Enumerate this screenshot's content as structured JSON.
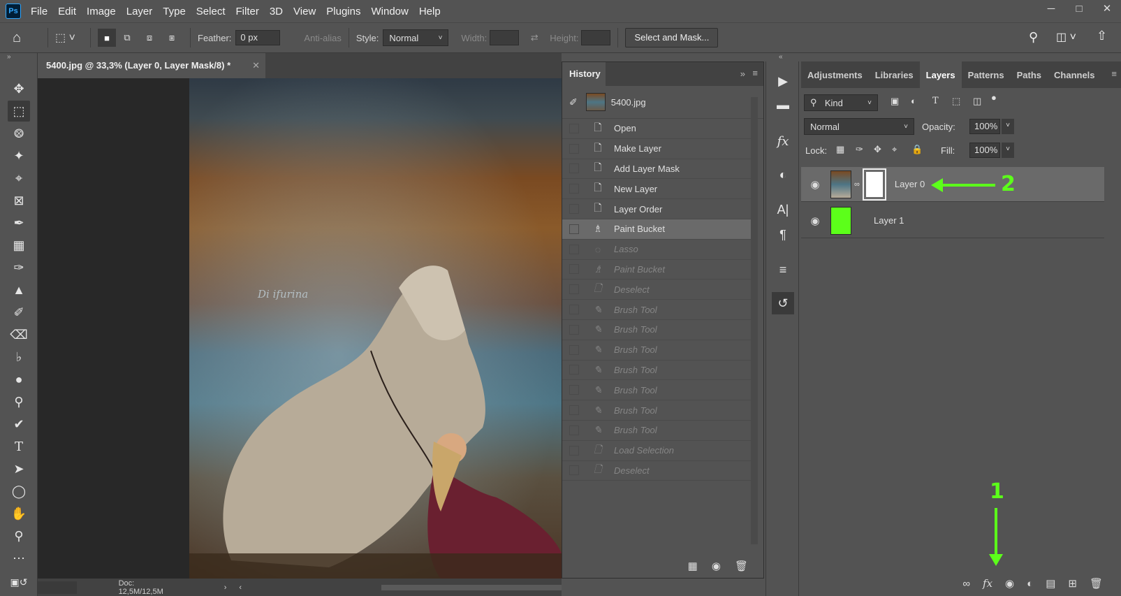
{
  "app": {
    "logo": "Ps"
  },
  "menu": [
    "File",
    "Edit",
    "Image",
    "Layer",
    "Type",
    "Select",
    "Filter",
    "3D",
    "View",
    "Plugins",
    "Window",
    "Help"
  ],
  "window_controls": [
    "minimize-icon",
    "restore-icon",
    "close-icon"
  ],
  "options": {
    "feather_label": "Feather:",
    "feather_value": "0 px",
    "antialias_label": "Anti-alias",
    "style_label": "Style:",
    "style_value": "Normal",
    "width_label": "Width:",
    "height_label": "Height:",
    "select_mask_label": "Select and Mask..."
  },
  "document": {
    "tab_title": "5400.jpg @ 33,3% (Layer 0, Layer Mask/8) *",
    "watermark": "Di ifurina",
    "status": "Doc: 12,5M/12,5M"
  },
  "history": {
    "title": "History",
    "snapshot": "5400.jpg",
    "items": [
      {
        "label": "Open",
        "icon": "document-icon",
        "state": "normal"
      },
      {
        "label": "Make Layer",
        "icon": "document-icon",
        "state": "normal"
      },
      {
        "label": "Add Layer Mask",
        "icon": "document-icon",
        "state": "normal"
      },
      {
        "label": "New Layer",
        "icon": "document-icon",
        "state": "normal"
      },
      {
        "label": "Layer Order",
        "icon": "document-icon",
        "state": "normal"
      },
      {
        "label": "Paint Bucket",
        "icon": "paint-bucket-icon",
        "state": "active"
      },
      {
        "label": "Lasso",
        "icon": "lasso-icon",
        "state": "undone"
      },
      {
        "label": "Paint Bucket",
        "icon": "paint-bucket-icon",
        "state": "undone"
      },
      {
        "label": "Deselect",
        "icon": "document-icon",
        "state": "undone"
      },
      {
        "label": "Brush Tool",
        "icon": "brush-icon",
        "state": "undone"
      },
      {
        "label": "Brush Tool",
        "icon": "brush-icon",
        "state": "undone"
      },
      {
        "label": "Brush Tool",
        "icon": "brush-icon",
        "state": "undone"
      },
      {
        "label": "Brush Tool",
        "icon": "brush-icon",
        "state": "undone"
      },
      {
        "label": "Brush Tool",
        "icon": "brush-icon",
        "state": "undone"
      },
      {
        "label": "Brush Tool",
        "icon": "brush-icon",
        "state": "undone"
      },
      {
        "label": "Brush Tool",
        "icon": "brush-icon",
        "state": "undone"
      },
      {
        "label": "Load Selection",
        "icon": "document-icon",
        "state": "undone"
      },
      {
        "label": "Deselect",
        "icon": "document-icon",
        "state": "undone"
      }
    ]
  },
  "layers_panel": {
    "tabs": [
      "Adjustments",
      "Libraries",
      "Layers",
      "Patterns",
      "Paths",
      "Channels"
    ],
    "active_tab": "Layers",
    "filter_kind": "Kind",
    "blend_mode": "Normal",
    "opacity_label": "Opacity:",
    "opacity_value": "100%",
    "lock_label": "Lock:",
    "fill_label": "Fill:",
    "fill_value": "100%",
    "layers": [
      {
        "name": "Layer 0",
        "selected": true,
        "has_mask": true
      },
      {
        "name": "Layer 1",
        "selected": false,
        "color": "#5cff1a"
      }
    ]
  },
  "annotations": {
    "first": "1",
    "second": "2",
    "color": "#5cff1a"
  }
}
